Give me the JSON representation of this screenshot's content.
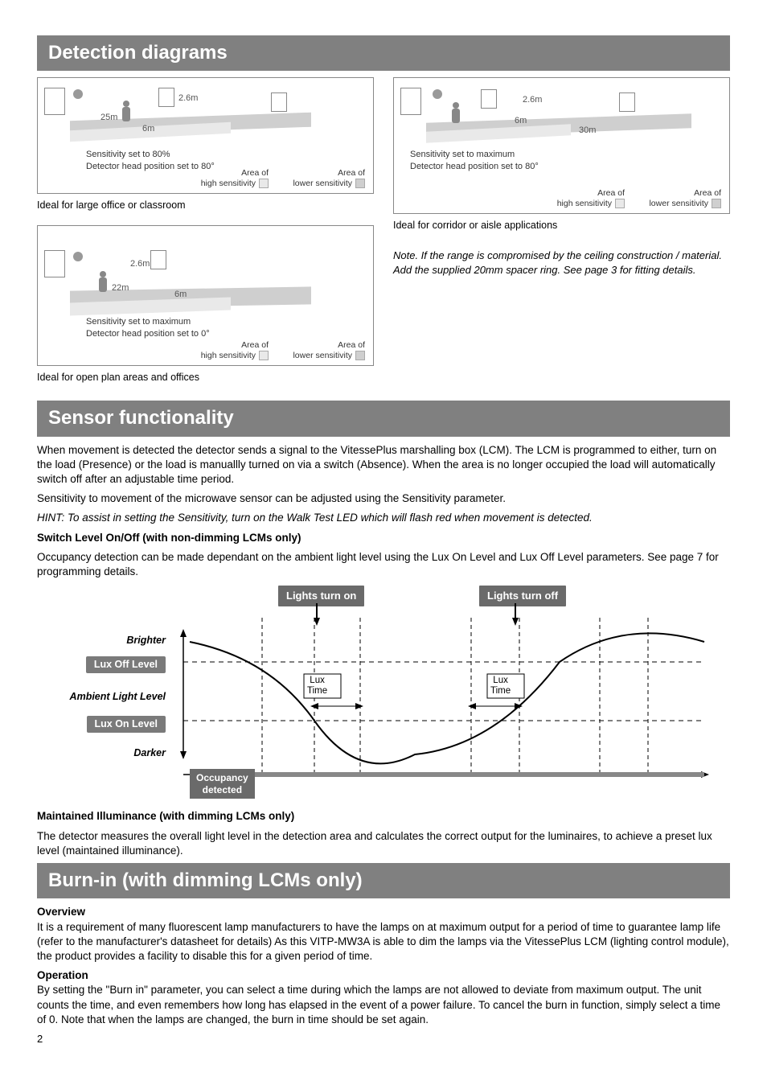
{
  "sections": {
    "detection": "Detection diagrams",
    "sensor": "Sensor functionality",
    "burnin": "Burn-in (with dimming LCMs only)"
  },
  "diagrams": {
    "d1": {
      "height": "2.6m",
      "range_far": "25m",
      "range_near": "6m",
      "settings_l1": "Sensitivity set to 80%",
      "settings_l2": "Detector head position set to 80°",
      "legend_hi": "Area of\nhigh sensitivity",
      "legend_lo": "Area of\nlower sensitivity",
      "caption": "Ideal for large office or classroom"
    },
    "d2": {
      "height": "2.6m",
      "range_mid": "22m",
      "range_near": "6m",
      "settings_l1": "Sensitivity set to maximum",
      "settings_l2": "Detector head position set to 0°",
      "legend_hi": "Area of\nhigh sensitivity",
      "legend_lo": "Area of\nlower sensitivity",
      "caption": "Ideal for open plan areas and offices"
    },
    "d3": {
      "height": "2.6m",
      "range_near": "6m",
      "range_far": "30m",
      "settings_l1": "Sensitivity set to maximum",
      "settings_l2": "Detector head position set to 80°",
      "legend_hi": "Area of\nhigh sensitivity",
      "legend_lo": "Area of\nlower sensitivity",
      "caption": "Ideal for corridor or aisle applications"
    },
    "note": "Note. If the range is compromised by the ceiling construction / material. Add the supplied 20mm spacer ring. See page 3 for fitting details."
  },
  "sensor_text": {
    "p1": "When movement is detected the detector sends a signal to the VitessePlus marshalling box (LCM). The LCM is programmed to either, turn on the load (Presence) or the load is manuallly turned on via a switch (Absence). When the area is no longer occupied the load will automatically switch off after an adjustable time period.",
    "p2": "Sensitivity to movement of the microwave sensor  can be adjusted using the Sensitivity parameter.",
    "hint": "HINT: To assist in setting the Sensitivity, turn on the Walk Test LED which will flash red when movement is detected.",
    "h_switch": "Switch Level On/Off (with non-dimming LCMs only)",
    "p_switch": "Occupancy detection can be made dependant on the ambient light level using the Lux On Level and Lux Off Level parameters. See page 7 for programming details.",
    "h_maint": "Maintained Illuminance (with dimming LCMs only)",
    "p_maint": "The detector measures the overall light level in the detection area and calculates the correct output for the luminaires, to achieve a preset lux level (maintained illuminance)."
  },
  "lux_diagram": {
    "lights_on": "Lights turn on",
    "lights_off": "Lights turn off",
    "brighter": "Brighter",
    "darker": "Darker",
    "lux_off": "Lux Off Level",
    "lux_on": "Lux On Level",
    "ambient": "Ambient Light Level",
    "lux_time": "Lux\nTime",
    "occupancy": "Occupancy\ndetected"
  },
  "burnin_text": {
    "h_overview": "Overview",
    "p_overview": "It is a requirement of many fluorescent lamp manufacturers to have the lamps on at maximum output for a period of time to guarantee lamp life (refer to the manufacturer's datasheet for details) As this VITP-MW3A is able to dim the lamps via the VitessePlus LCM (lighting control module), the product provides a facility to disable this for a given period of time.",
    "h_operation": "Operation",
    "p_operation": "By setting the \"Burn in\" parameter, you can select a time during which the lamps are not allowed to deviate from maximum output. The unit counts the time, and even remembers how long has elapsed in the event of a power failure. To cancel the burn in function, simply select a time of 0. Note that when the lamps are changed, the burn in time should be set again."
  },
  "page_number": "2"
}
